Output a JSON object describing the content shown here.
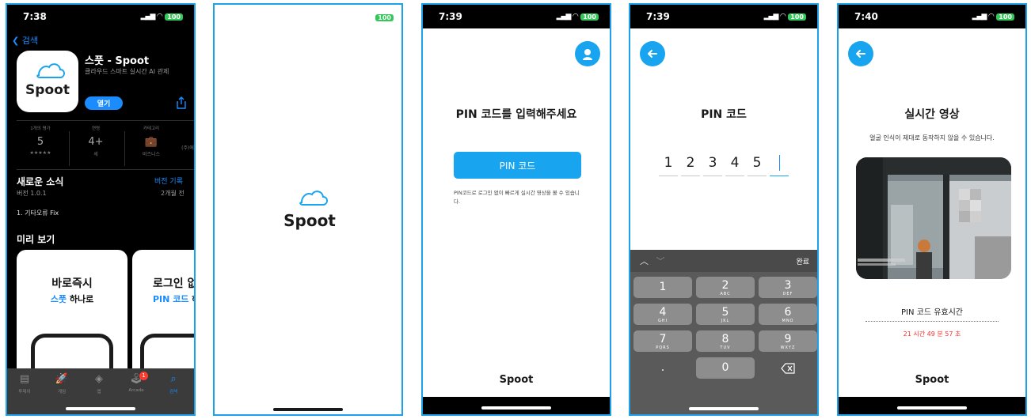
{
  "appstore": {
    "status": {
      "time": "7:38",
      "battery": "100"
    },
    "back_label": "검색",
    "app_name": "스풋 - Spoot",
    "app_subtitle": "클라우드 스마트 실시간 AI 관제",
    "icon_logo": "Spoot",
    "open_label": "열기",
    "info": [
      {
        "head": "1개의 평가",
        "value": "5",
        "foot": "★★★★★"
      },
      {
        "head": "연령",
        "value": "4+",
        "foot": "세"
      },
      {
        "head": "카테고리",
        "value": "",
        "foot": "비즈니스"
      },
      {
        "head": "",
        "value": "",
        "foot": "(주)에"
      }
    ],
    "whats_new": "새로운 소식",
    "version_history": "버전 기록",
    "version": "버전 1.0.1",
    "ago": "2개월 전",
    "notes": "1. 기타오류 Fix",
    "preview_title": "미리 보기",
    "card1": {
      "line1": "바로즉시",
      "line2_blue": "스풋",
      "line2_rest": " 하나로"
    },
    "card2": {
      "line1": "로그인 없",
      "line2_blue": "PIN 코드 ",
      "line2_rest": "하"
    },
    "tabs": [
      {
        "icon": "today-icon",
        "label": "투데이"
      },
      {
        "icon": "games-icon",
        "label": "게임"
      },
      {
        "icon": "apps-icon",
        "label": "앱"
      },
      {
        "icon": "arcade-icon",
        "label": "Arcade",
        "badge": "1"
      },
      {
        "icon": "search-icon",
        "label": "검색"
      }
    ]
  },
  "splash": {
    "battery": "100",
    "logo": "Spoot"
  },
  "pin": {
    "status": {
      "time": "7:39",
      "battery": "100"
    },
    "title": "PIN 코드를 입력해주세요",
    "button_label": "PIN 코드",
    "note": "PIN코드로 로그인 없이 빠르게 실시간 영상을 볼 수 있습니다.",
    "footer_logo": "Spoot"
  },
  "pin_entry": {
    "status": {
      "time": "7:39",
      "battery": "100"
    },
    "title": "PIN 코드",
    "digits": [
      "1",
      "2",
      "3",
      "4",
      "5"
    ],
    "done_label": "완료",
    "keys": [
      {
        "num": "1",
        "letters": ""
      },
      {
        "num": "2",
        "letters": "ABC"
      },
      {
        "num": "3",
        "letters": "DEF"
      },
      {
        "num": "4",
        "letters": "GHI"
      },
      {
        "num": "5",
        "letters": "JKL"
      },
      {
        "num": "6",
        "letters": "MNO"
      },
      {
        "num": "7",
        "letters": "PQRS"
      },
      {
        "num": "8",
        "letters": "TUV"
      },
      {
        "num": "9",
        "letters": "WXYZ"
      },
      {
        "num": ".",
        "letters": ""
      },
      {
        "num": "0",
        "letters": ""
      }
    ]
  },
  "live": {
    "status": {
      "time": "7:40",
      "battery": "100"
    },
    "title": "실시간 영상",
    "warning": "얼굴 인식이 제대로 동작하지 않을 수 있습니다.",
    "valid_label": "PIN 코드 유효시간",
    "remaining": "21 시간 49 분 57 초",
    "footer_logo": "Spoot"
  },
  "colors": {
    "accent": "#18a4ef",
    "ios_blue": "#1a8cff",
    "alert_red": "#ff2d2d"
  }
}
